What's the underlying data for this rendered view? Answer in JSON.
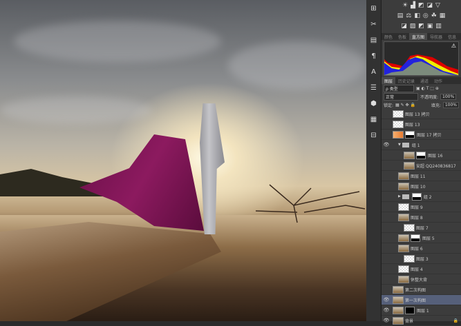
{
  "adjustments": {
    "row1": [
      "☀",
      "▟",
      "◩",
      "◪",
      "▽"
    ],
    "row2": [
      "▤",
      "⚖",
      "◧",
      "◎",
      "☘",
      "▦"
    ],
    "row3": [
      "◪",
      "▨",
      "◩",
      "▣",
      "▥"
    ]
  },
  "info_tabs": [
    "颜色",
    "色板",
    "直方图",
    "导航器",
    "信息"
  ],
  "histogram": {
    "warning_icon": "⚠"
  },
  "layer_tabs": [
    "图层",
    "历史记录",
    "通道",
    "动作"
  ],
  "filter": {
    "kind": "ρ 类型"
  },
  "blend_mode": "正常",
  "opacity_label": "不透明度:",
  "opacity": "100%",
  "lock_label": "锁定:",
  "fill_label": "填充:",
  "fill": "100%",
  "layers": [
    {
      "name": "图层 13 拷贝"
    },
    {
      "name": "图层 13"
    },
    {
      "name": "图层 17 拷贝"
    },
    {
      "name": "组 1"
    },
    {
      "name": "图层 16"
    },
    {
      "name": "安超 QQ240836817"
    },
    {
      "name": "图层 11"
    },
    {
      "name": "图层 10"
    },
    {
      "name": "组 2"
    },
    {
      "name": "图层 9"
    },
    {
      "name": "图层 8"
    },
    {
      "name": "图层 7"
    },
    {
      "name": "图层 5"
    },
    {
      "name": "图层 6"
    },
    {
      "name": "图层 3"
    },
    {
      "name": "图层 4"
    },
    {
      "name": "休整大背"
    },
    {
      "name": "第二次构图"
    },
    {
      "name": "第一次构图"
    },
    {
      "name": "图层 1"
    },
    {
      "name": "背景"
    }
  ]
}
